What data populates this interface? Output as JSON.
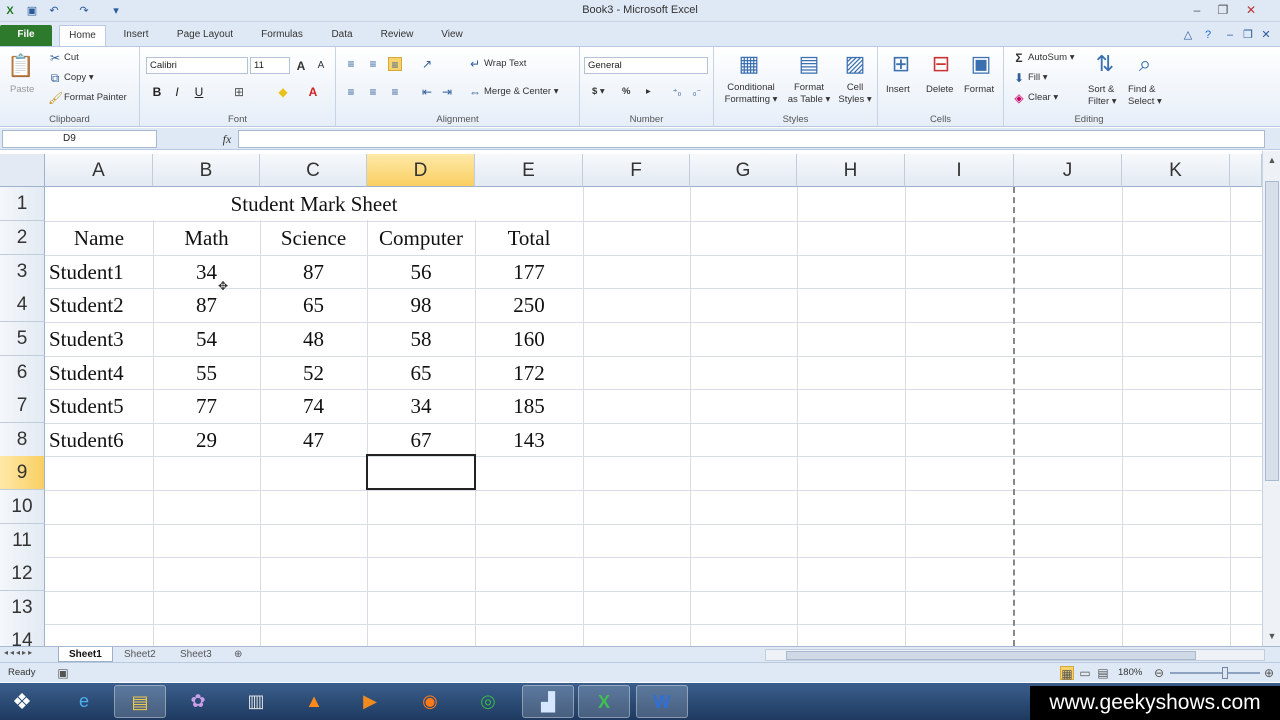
{
  "window": {
    "title": "Book3 - Microsoft Excel"
  },
  "tabs": [
    "File",
    "Home",
    "Insert",
    "Page Layout",
    "Formulas",
    "Data",
    "Review",
    "View"
  ],
  "ribbon": {
    "clipboard": {
      "label": "Clipboard",
      "paste": "Paste",
      "cut": "Cut",
      "copy": "Copy ▾",
      "format_painter": "Format Painter"
    },
    "font": {
      "label": "Font",
      "name": "Calibri",
      "size": "11"
    },
    "alignment": {
      "label": "Alignment",
      "wrap_text": "Wrap Text",
      "merge_center": "Merge & Center ▾"
    },
    "number": {
      "label": "Number",
      "format": "General",
      "currency": "$ ▾",
      "percent": "%",
      "comma": "▸"
    },
    "styles": {
      "label": "Styles",
      "conditional": "Conditional",
      "conditional2": "Formatting ▾",
      "format_table": "Format",
      "format_table2": "as Table ▾",
      "cell_styles": "Cell",
      "cell_styles2": "Styles ▾"
    },
    "cells": {
      "label": "Cells",
      "insert": "Insert",
      "delete": "Delete",
      "format": "Format"
    },
    "editing": {
      "label": "Editing",
      "autosum": "AutoSum ▾",
      "fill": "Fill ▾",
      "clear": "Clear ▾",
      "sort": "Sort &",
      "sort2": "Filter ▾",
      "find": "Find &",
      "find2": "Select ▾"
    }
  },
  "formula_bar": {
    "name_box": "D9",
    "fx": "fx",
    "value": ""
  },
  "columns": [
    "A",
    "B",
    "C",
    "D",
    "E",
    "F",
    "G",
    "H",
    "I",
    "J",
    "K"
  ],
  "rows": [
    "1",
    "2",
    "3",
    "4",
    "5",
    "6",
    "7",
    "8",
    "9",
    "10",
    "11",
    "12",
    "13",
    "14"
  ],
  "sheet": {
    "title": "Student Mark Sheet",
    "headers": [
      "Name",
      "Math",
      "Science",
      "Computer",
      "Total"
    ],
    "data": [
      [
        "Student1",
        "34",
        "87",
        "56",
        "177"
      ],
      [
        "Student2",
        "87",
        "65",
        "98",
        "250"
      ],
      [
        "Student3",
        "54",
        "48",
        "58",
        "160"
      ],
      [
        "Student4",
        "55",
        "52",
        "65",
        "172"
      ],
      [
        "Student5",
        "77",
        "74",
        "34",
        "185"
      ],
      [
        "Student6",
        "29",
        "47",
        "67",
        "143"
      ]
    ]
  },
  "sheet_tabs": [
    "Sheet1",
    "Sheet2",
    "Sheet3"
  ],
  "status": {
    "ready": "Ready",
    "zoom": "180%"
  },
  "watermark": "www.geekyshows.com"
}
